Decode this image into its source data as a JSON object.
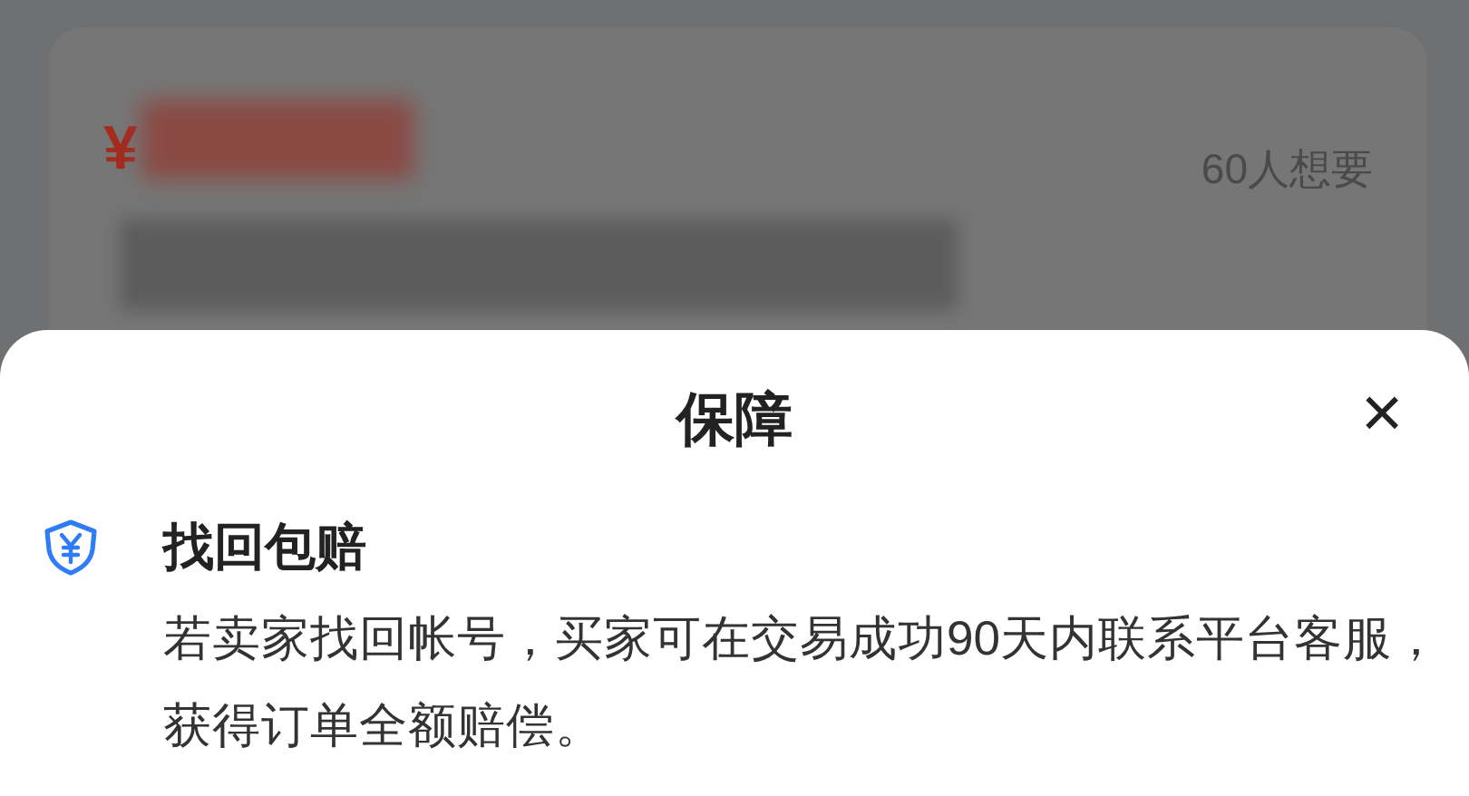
{
  "listing": {
    "currency": "¥",
    "wants": "60人想要"
  },
  "sheet": {
    "title": "保障",
    "close": "×",
    "items": [
      {
        "title": "找回包赔",
        "description": "若卖家找回帐号，买家可在交易成功90天内联系平台客服，获得订单全额赔偿。"
      }
    ]
  }
}
